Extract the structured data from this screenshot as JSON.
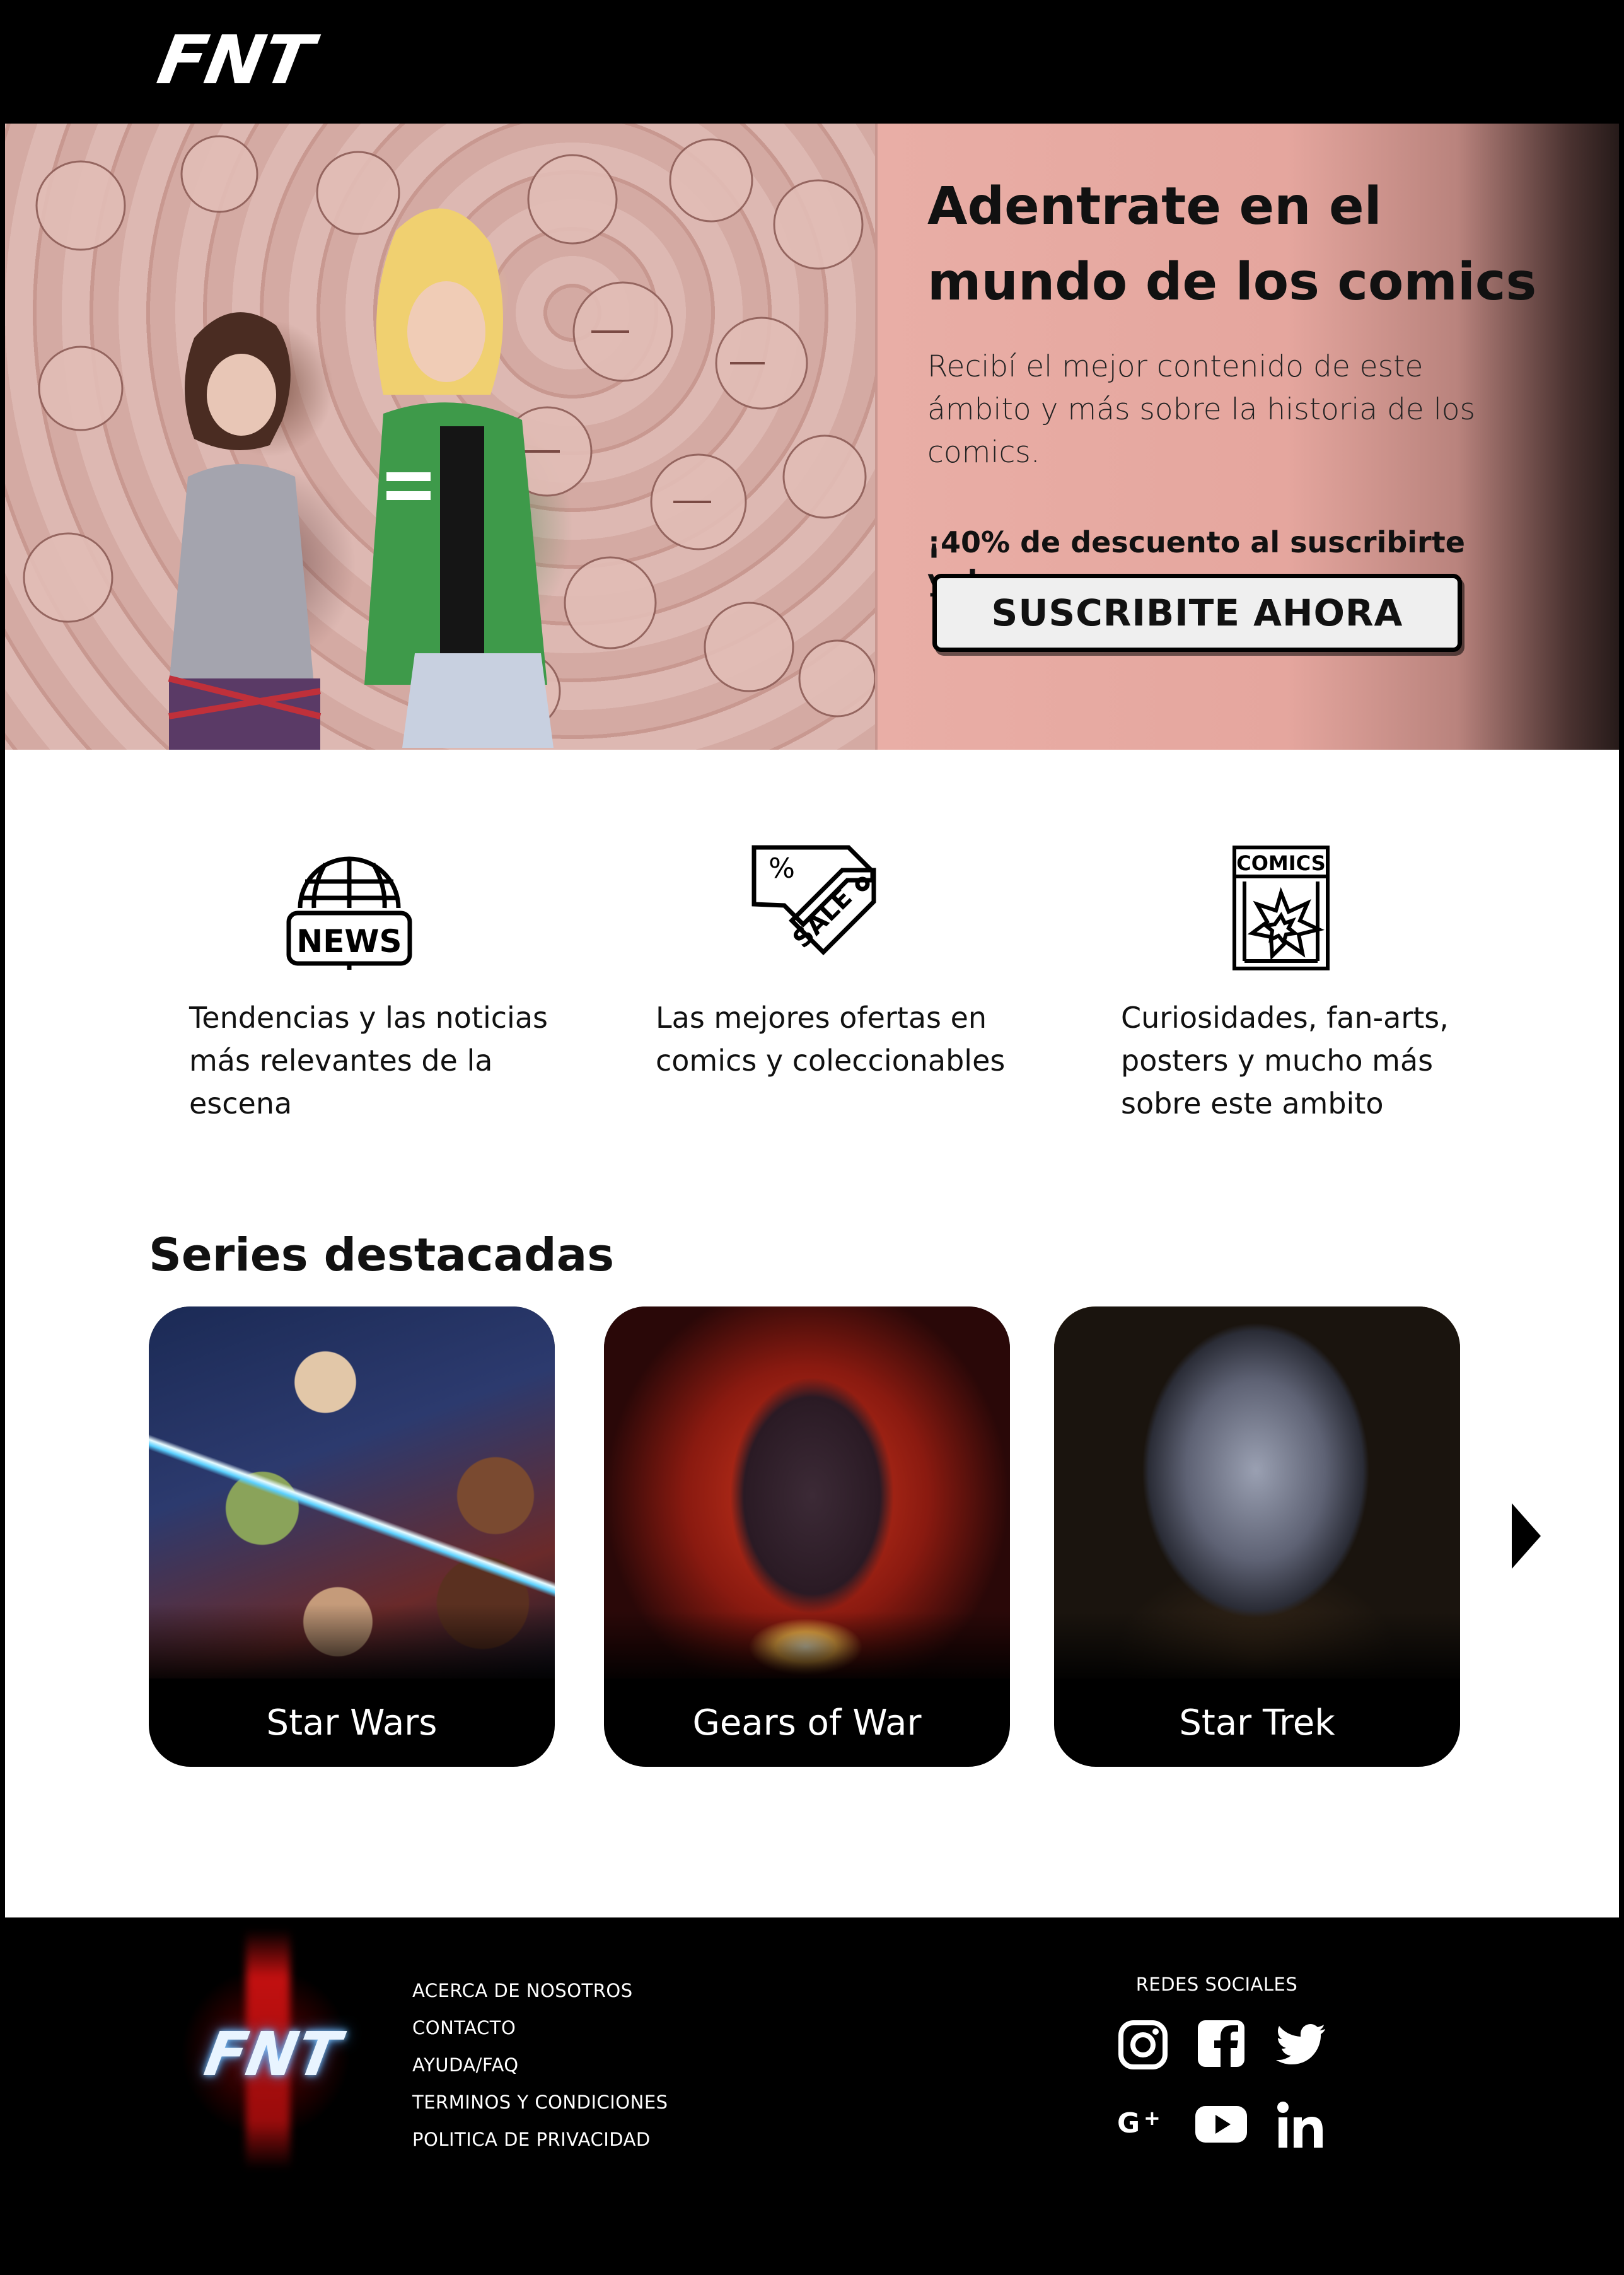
{
  "header": {
    "logo_text": "FNT"
  },
  "hero": {
    "title": "Adentrate en el mundo de los comics",
    "subtitle": "Recibí el mejor contenido de este ámbito y más sobre la historia de los comics.",
    "promo": "¡40% de descuento al suscribirte ya!",
    "cta_label": "SUSCRIBITE AHORA"
  },
  "features": [
    {
      "icon": "news-globe-icon",
      "text": "Tendencias y las noticias más relevantes de la escena"
    },
    {
      "icon": "sale-tag-icon",
      "text": "Las mejores ofertas en comics y coleccionables"
    },
    {
      "icon": "comics-book-icon",
      "text": "Curiosidades, fan-arts, posters y mucho más sobre este ambito"
    }
  ],
  "icon_labels": {
    "news": "NEWS",
    "sale": "SALE",
    "comics": "COMICS"
  },
  "featured": {
    "title": "Series destacadas",
    "series": [
      {
        "label": "Star Wars"
      },
      {
        "label": "Gears of War"
      },
      {
        "label": "Star Trek"
      }
    ],
    "next_icon": "chevron-right-icon"
  },
  "footer": {
    "logo_text": "FNT",
    "links": [
      "ACERCA DE NOSOTROS",
      "CONTACTO",
      "AYUDA/FAQ",
      "TERMINOS Y CONDICIONES",
      "POLITICA DE PRIVACIDAD"
    ],
    "social_title": "REDES SOCIALES",
    "social_icons": [
      "instagram-icon",
      "facebook-icon",
      "twitter-icon",
      "google-plus-icon",
      "youtube-icon",
      "linkedin-icon"
    ]
  },
  "colors": {
    "hero_panel": "#e5a69e",
    "background_dark": "#000000",
    "content_background": "#ffffff",
    "button_background": "#efefef"
  }
}
